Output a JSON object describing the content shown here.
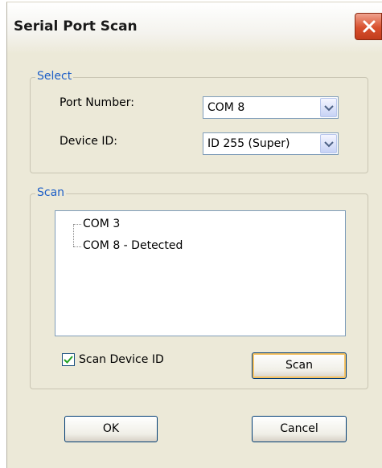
{
  "window": {
    "title": "Serial Port Scan"
  },
  "select_group": {
    "legend": "Select",
    "port_number_label": "Port Number:",
    "port_number_value": "COM 8",
    "device_id_label": "Device ID:",
    "device_id_value": "ID 255 (Super)"
  },
  "scan_group": {
    "legend": "Scan",
    "tree_items": [
      "COM 3",
      "COM 8 - Detected"
    ],
    "scan_device_id_label": "Scan Device ID",
    "scan_device_id_checked": true,
    "scan_button": "Scan"
  },
  "buttons": {
    "ok": "OK",
    "cancel": "Cancel"
  },
  "colors": {
    "accent": "#1c5ec7",
    "dialog_bg": "#ece9d8",
    "close": "#d8502e"
  }
}
